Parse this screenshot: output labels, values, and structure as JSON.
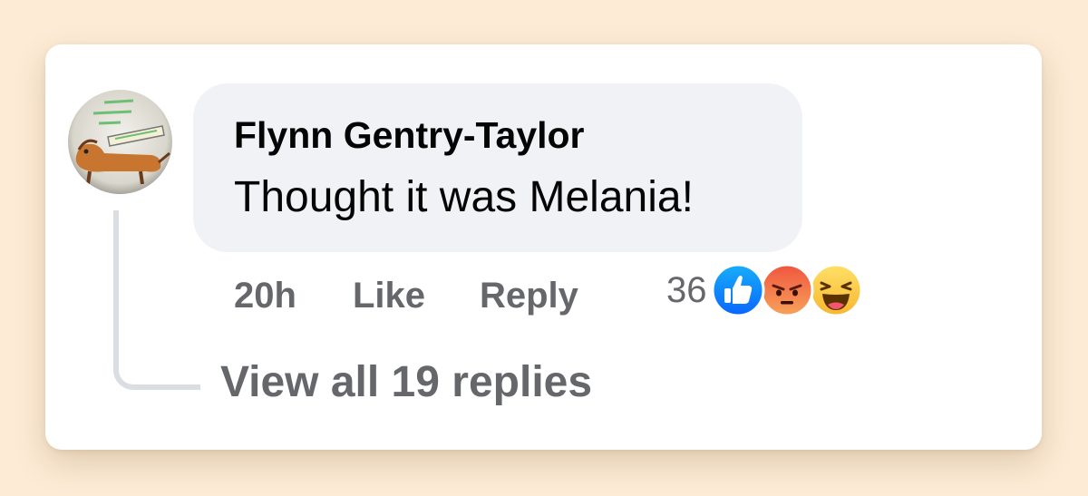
{
  "comment": {
    "author": "Flynn Gentry-Taylor",
    "text": "Thought it was Melania!",
    "timestamp": "20h",
    "like_label": "Like",
    "reply_label": "Reply",
    "reaction_count": "36",
    "reactions": [
      "like-icon",
      "angry-icon",
      "haha-icon"
    ],
    "view_replies_label": "View all 19 replies"
  },
  "colors": {
    "page_background": "#fdebd5",
    "card_background": "#ffffff",
    "bubble_background": "#f0f2f5",
    "secondary_text": "#65676b",
    "like_blue": "#1877f2"
  }
}
